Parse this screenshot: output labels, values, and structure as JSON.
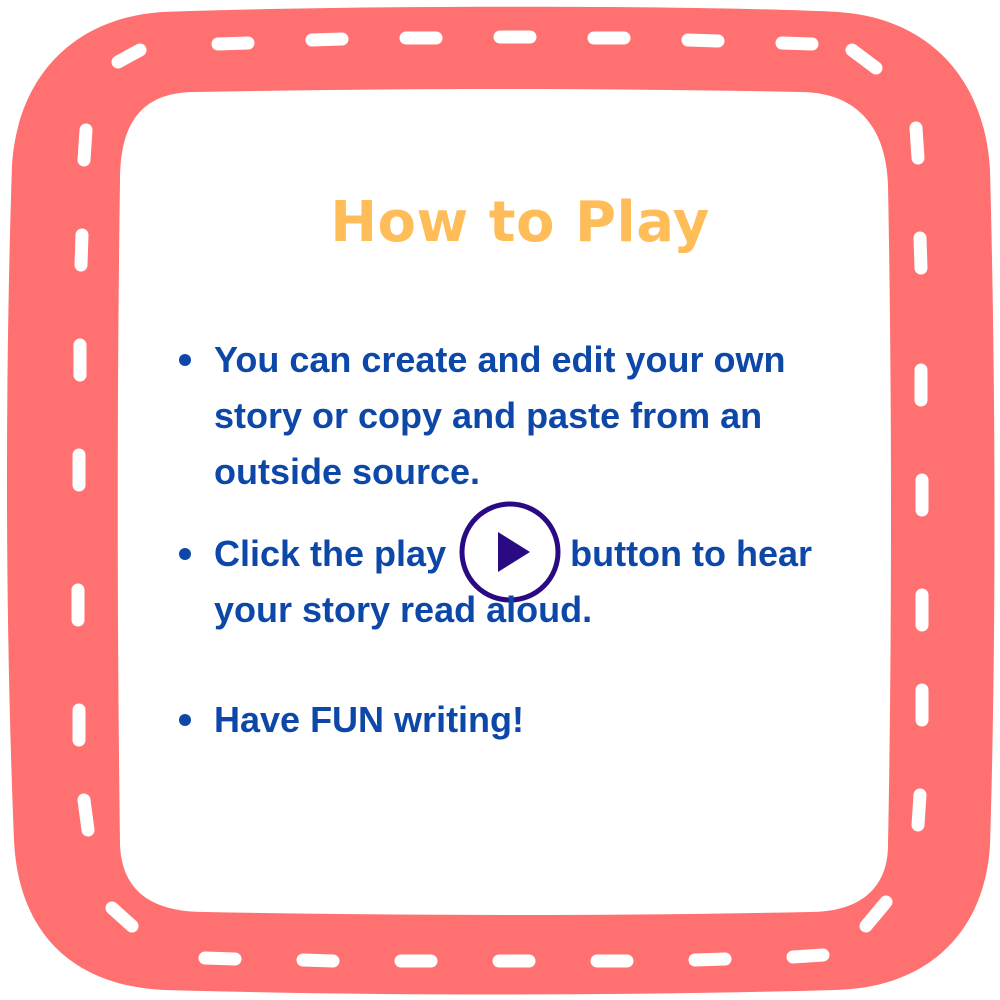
{
  "title": "How to Play",
  "colors": {
    "frame": "#ff7070",
    "title": "#ffbd59",
    "text": "#0d48a8",
    "play_icon": "#2a0a82"
  },
  "instructions": [
    {
      "text": "You can create and edit your own story or copy and paste from an outside source."
    },
    {
      "text_before_icon": "Click the play",
      "icon": "play-circle-icon",
      "text_after_icon": "button to hear your story read aloud."
    },
    {
      "text": "Have FUN writing!"
    }
  ]
}
